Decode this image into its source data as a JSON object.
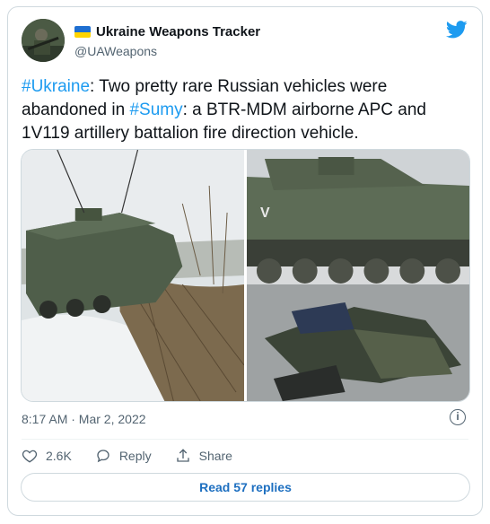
{
  "author": {
    "name": "Ukraine Weapons Tracker",
    "handle": "@UAWeapons"
  },
  "tweet": {
    "parts": [
      {
        "text": "#Ukraine",
        "type": "hashtag"
      },
      {
        "text": ": Two pretty rare Russian vehicles were abandoned in ",
        "type": "text"
      },
      {
        "text": "#Sumy",
        "type": "hashtag"
      },
      {
        "text": ": a BTR-MDM airborne APC and 1V119 artillery battalion fire direction vehicle.",
        "type": "text"
      }
    ],
    "timestamp": "8:17 AM · Mar 2, 2022"
  },
  "actions": {
    "likes": "2.6K",
    "reply_label": "Reply",
    "share_label": "Share"
  },
  "read_replies_label": "Read 57 replies",
  "colors": {
    "link": "#1d9bf0",
    "text": "#0f1419",
    "secondary": "#536471",
    "twitter_blue": "#1d9bf0"
  },
  "icons": [
    "verified-flag-icon",
    "twitter-bird-icon",
    "info-icon",
    "heart-icon",
    "reply-icon",
    "share-icon"
  ]
}
